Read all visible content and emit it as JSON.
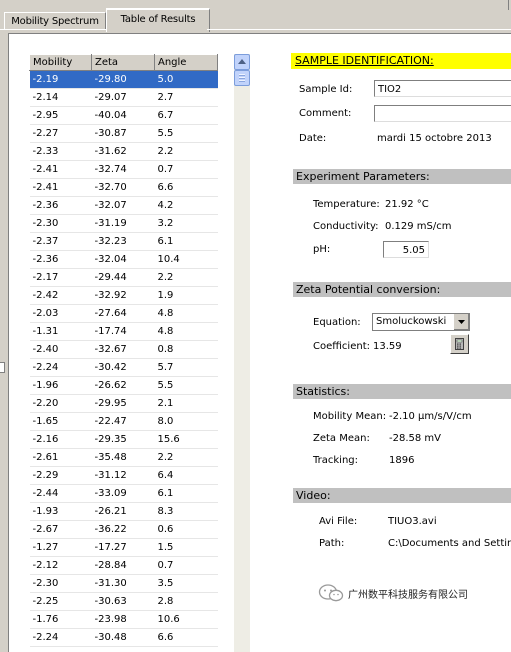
{
  "tabs": [
    "Mobility Spectrum",
    "Table of Results"
  ],
  "active_tab": "Table of Results",
  "table": {
    "columns": [
      "Mobility",
      "Zeta",
      "Angle"
    ],
    "selected_row": 0,
    "rows": [
      [
        "-2.19",
        "-29.80",
        "5.0"
      ],
      [
        "-2.14",
        "-29.07",
        "2.7"
      ],
      [
        "-2.95",
        "-40.04",
        "6.7"
      ],
      [
        "-2.27",
        "-30.87",
        "5.5"
      ],
      [
        "-2.33",
        "-31.62",
        "2.2"
      ],
      [
        "-2.41",
        "-32.74",
        "0.7"
      ],
      [
        "-2.41",
        "-32.70",
        "6.6"
      ],
      [
        "-2.36",
        "-32.07",
        "4.2"
      ],
      [
        "-2.30",
        "-31.19",
        "3.2"
      ],
      [
        "-2.37",
        "-32.23",
        "6.1"
      ],
      [
        "-2.36",
        "-32.04",
        "10.4"
      ],
      [
        "-2.17",
        "-29.44",
        "2.2"
      ],
      [
        "-2.42",
        "-32.92",
        "1.9"
      ],
      [
        "-2.03",
        "-27.64",
        "4.8"
      ],
      [
        "-1.31",
        "-17.74",
        "4.8"
      ],
      [
        "-2.40",
        "-32.67",
        "0.8"
      ],
      [
        "-2.24",
        "-30.42",
        "5.7"
      ],
      [
        "-1.96",
        "-26.62",
        "5.5"
      ],
      [
        "-2.20",
        "-29.95",
        "2.1"
      ],
      [
        "-1.65",
        "-22.47",
        "8.0"
      ],
      [
        "-2.16",
        "-29.35",
        "15.6"
      ],
      [
        "-2.61",
        "-35.48",
        "2.2"
      ],
      [
        "-2.29",
        "-31.12",
        "6.4"
      ],
      [
        "-2.44",
        "-33.09",
        "6.1"
      ],
      [
        "-1.93",
        "-26.21",
        "8.3"
      ],
      [
        "-2.67",
        "-36.22",
        "0.6"
      ],
      [
        "-1.27",
        "-17.27",
        "1.5"
      ],
      [
        "-2.12",
        "-28.84",
        "0.7"
      ],
      [
        "-2.30",
        "-31.30",
        "3.5"
      ],
      [
        "-2.25",
        "-30.63",
        "2.8"
      ],
      [
        "-1.76",
        "-23.98",
        "10.6"
      ],
      [
        "-2.24",
        "-30.48",
        "6.6"
      ]
    ]
  },
  "sample": {
    "header": "SAMPLE IDENTIFICATION:",
    "sample_id_label": "Sample Id:",
    "sample_id": "TIO2",
    "comment_label": "Comment:",
    "comment": "",
    "date_label": "Date:",
    "date": "mardi 15 octobre 2013"
  },
  "experiment": {
    "header": "Experiment Parameters:",
    "temperature_label": "Temperature:",
    "temperature": "21.92 °C",
    "conductivity_label": "Conductivity:",
    "conductivity": "0.129 mS/cm",
    "ph_label": "pH:",
    "ph": "5.05"
  },
  "conversion": {
    "header": "Zeta Potential conversion:",
    "equation_label": "Equation:",
    "equation": "Smoluckowski",
    "coefficient_label": "Coefficient:",
    "coefficient": "13.59"
  },
  "statistics": {
    "header": "Statistics:",
    "mobility_mean_label": "Mobility Mean:",
    "mobility_mean": "-2.10  μm/s/V/cm",
    "zeta_mean_label": "Zeta Mean:",
    "zeta_mean": "-28.58 mV",
    "tracking_label": "Tracking:",
    "tracking": "1896"
  },
  "video": {
    "header": "Video:",
    "avi_label": "Avi File:",
    "avi_file": "TIUO3.avi",
    "path_label": "Path:",
    "path": "C:\\Documents and Settings"
  },
  "watermark": {
    "text": "广州数平科技服务有限公司",
    "icon": "wechat-icon"
  },
  "icons": {
    "scroll_up": "arrow-up-icon",
    "dropdown": "chevron-down-icon",
    "calculator": "calculator-icon"
  },
  "colors": {
    "selection": "#316ac5",
    "sample_header": "#ffff00",
    "section_header": "#c0c0c0",
    "window": "#d4d0c8"
  }
}
